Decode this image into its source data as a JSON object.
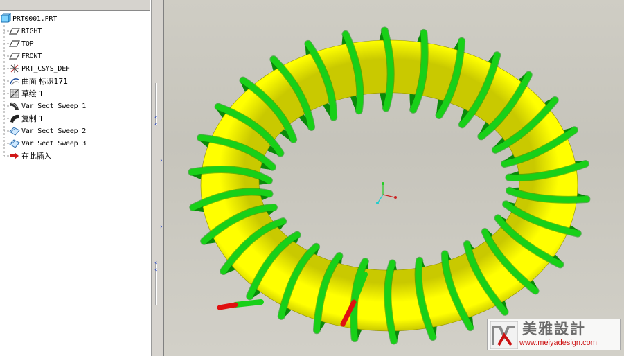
{
  "model_tree": {
    "items": [
      {
        "label": "PRT0001.PRT",
        "icon": "part-icon"
      },
      {
        "label": "RIGHT",
        "icon": "datum-plane-icon"
      },
      {
        "label": "TOP",
        "icon": "datum-plane-icon"
      },
      {
        "label": "FRONT",
        "icon": "datum-plane-icon"
      },
      {
        "label": "PRT_CSYS_DEF",
        "icon": "coordinate-system-icon"
      },
      {
        "label": "曲面 标识171",
        "icon": "surface-icon"
      },
      {
        "label": "草绘 1",
        "icon": "sketch-icon"
      },
      {
        "label": "Var Sect Sweep 1",
        "icon": "var-sect-sweep-icon"
      },
      {
        "label": "复制 1",
        "icon": "copy-feature-icon"
      },
      {
        "label": "Var Sect Sweep 2",
        "icon": "var-sect-sweep-surface-icon"
      },
      {
        "label": "Var Sect Sweep 3",
        "icon": "var-sect-sweep-surface-icon"
      },
      {
        "label": "在此插入",
        "icon": "insert-here-arrow-icon"
      }
    ]
  },
  "viewport": {
    "torus_color": "#ffff00",
    "torus_shade": "#c9c900",
    "coil_color": "#18d018",
    "coil_shade": "#0a8a0a",
    "coil_end_color": "#e01010",
    "coil_turns": 30,
    "background_color": "#cbc9c0"
  },
  "watermark": {
    "title": "美雅設計",
    "url": "www.meiyadesign.com",
    "accent": "#cc1111"
  }
}
